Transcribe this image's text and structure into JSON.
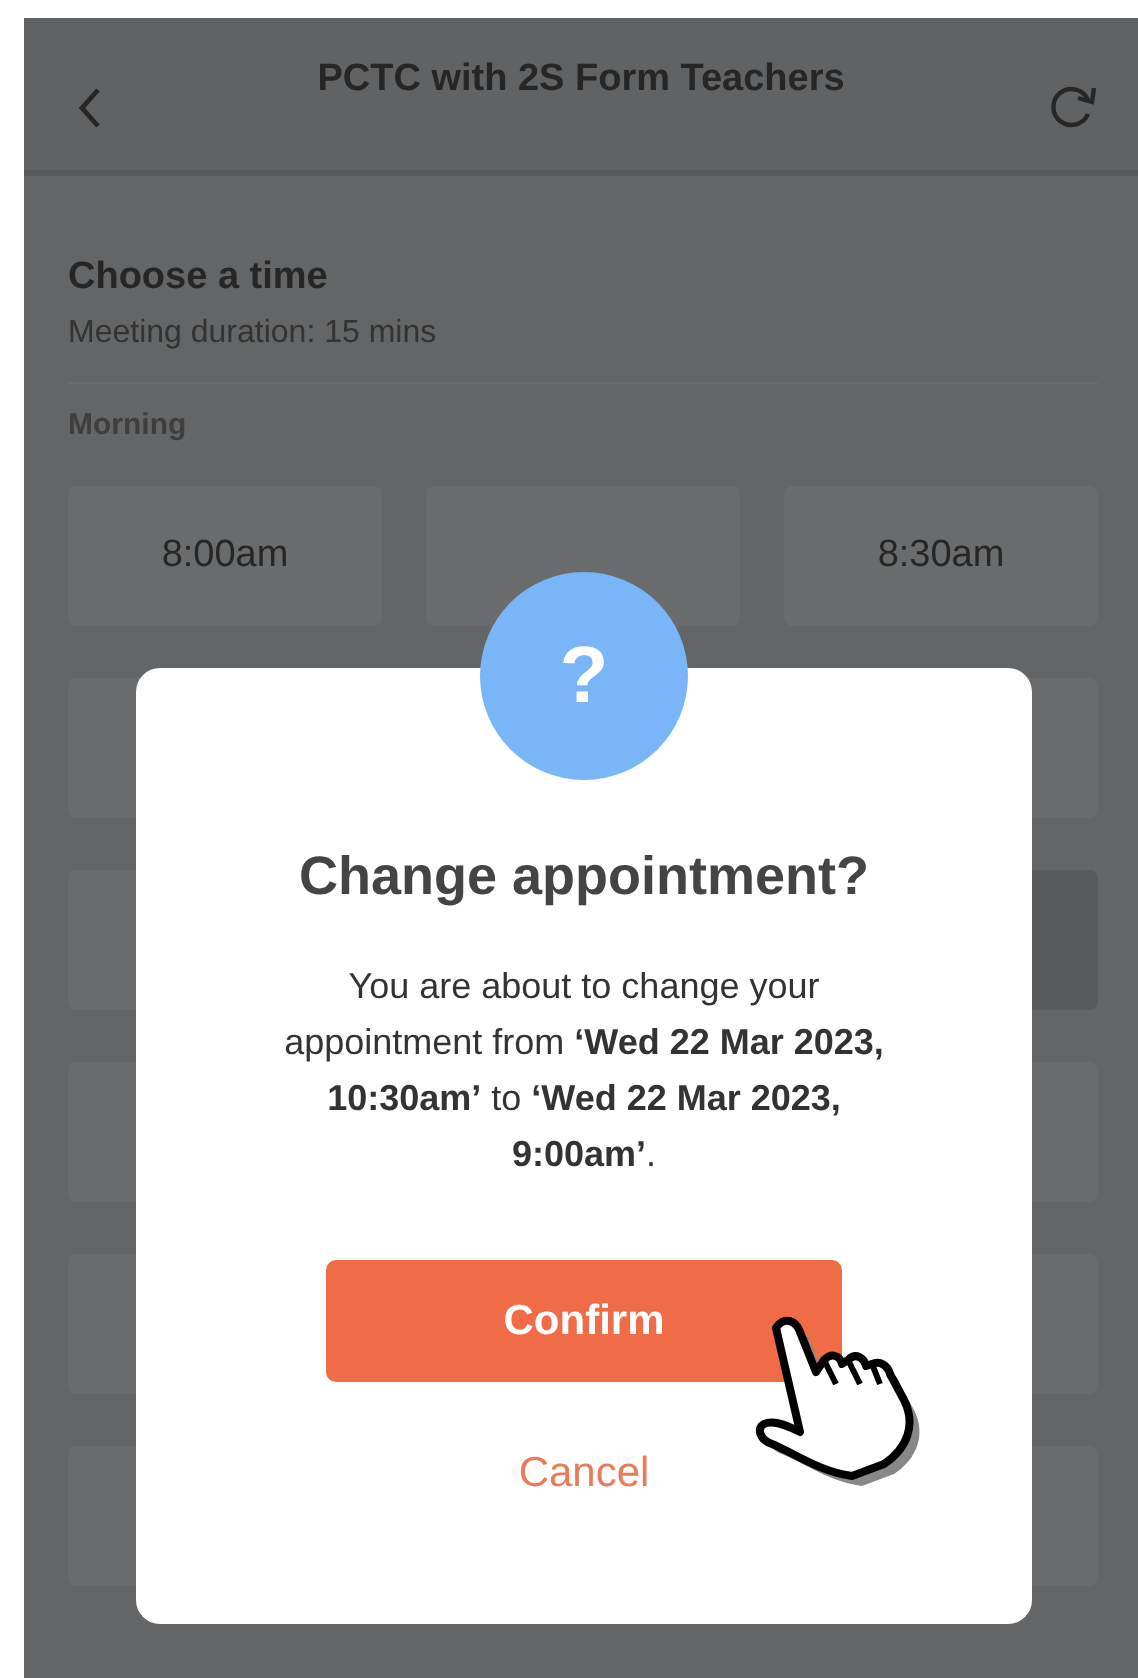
{
  "header": {
    "title": "PCTC with 2S Form Teachers"
  },
  "section": {
    "title": "Choose a time",
    "subtitle": "Meeting duration: 15 mins",
    "group_label": "Morning"
  },
  "slot_rows": [
    {
      "slots": [
        {
          "label": "8:00am",
          "selected": false
        },
        {
          "selected": false
        },
        {
          "label": "8:30am",
          "selected": false
        }
      ]
    },
    {
      "slots": [
        {
          "selected": false
        },
        {
          "selected": false
        }
      ]
    },
    {
      "slots": [
        {
          "selected": false
        },
        {
          "selected": true
        }
      ]
    },
    {
      "slots": [
        {
          "selected": false
        },
        {
          "selected": false
        }
      ]
    },
    {
      "slots": [
        {
          "selected": false
        },
        {
          "selected": false
        }
      ]
    },
    {
      "slots": [
        {
          "selected": false
        },
        {
          "selected": false
        }
      ]
    }
  ],
  "dialog": {
    "icon": "?",
    "title": "Change appointment?",
    "message": "You are about to change your appointment from **‘Wed 22 Mar 2023, 10:30am’** to **‘Wed 22 Mar 2023, 9:00am’**.",
    "buttons": [
      {
        "label": "Confirm",
        "kind": "primary"
      },
      {
        "label": "Cancel",
        "kind": "link"
      }
    ]
  }
}
